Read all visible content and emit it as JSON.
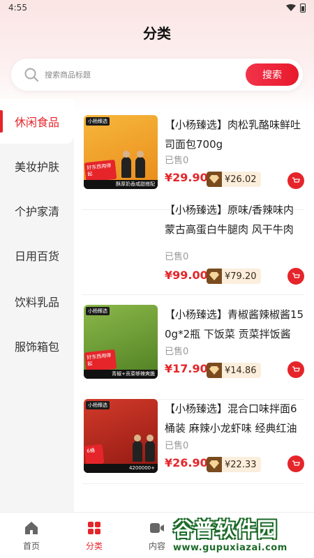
{
  "status_bar": {
    "time": "4:55"
  },
  "page_title": "分类",
  "search": {
    "placeholder": "搜索商品标题",
    "button_label": "搜索"
  },
  "sidebar": {
    "items": [
      {
        "label": "休闲食品",
        "active": true
      },
      {
        "label": "美妆护肤",
        "active": false
      },
      {
        "label": "个护家清",
        "active": false
      },
      {
        "label": "日用百货",
        "active": false
      },
      {
        "label": "饮料乳品",
        "active": false
      },
      {
        "label": "服饰箱包",
        "active": false
      }
    ]
  },
  "products": [
    {
      "title": "【小杨臻选】肉松乳酪味鲜吐司面包700g",
      "sold": "已售0",
      "price": "¥29.90",
      "vip_price": "¥26.02",
      "image": {
        "brand": "小杨臻选",
        "badge": "好东西用得起",
        "strip": "酥厚奶香咸甜搭配",
        "colors": [
          "#f6b73c",
          "#e98a1a"
        ]
      }
    },
    {
      "title": "【小杨臻选】原味/香辣味内蒙古高蛋白牛腿肉 风干牛肉",
      "sold": "已售0",
      "price": "¥99.00",
      "vip_price": "¥79.20",
      "image": null
    },
    {
      "title": "【小杨臻选】青椒酱辣椒酱150g*2瓶 下饭菜 贡菜拌饭酱",
      "sold": "已售0",
      "price": "¥17.90",
      "vip_price": "¥14.86",
      "image": {
        "brand": "小杨臻选",
        "badge": "好东西用得起",
        "strip": "青椒+贡菜够辣爽脆",
        "colors": [
          "#7fae3a",
          "#4f7f22"
        ]
      }
    },
    {
      "title": "【小杨臻选】混合口味拌面6桶装 麻辣小龙虾味 经典红油",
      "sold": "已售0",
      "price": "¥26.90",
      "vip_price": "¥22.33",
      "image": {
        "brand": "小杨臻选",
        "badge": "6桶",
        "strip": "4200000+",
        "colors": [
          "#c42a1e",
          "#8f1811"
        ]
      }
    }
  ],
  "tabbar": {
    "items": [
      {
        "label": "首页",
        "icon": "home-icon",
        "active": false
      },
      {
        "label": "分类",
        "icon": "category-icon",
        "active": true
      },
      {
        "label": "内容",
        "icon": "video-icon",
        "active": false
      }
    ]
  },
  "watermark": {
    "title": "谷普软件园",
    "url": "www.gupuxiazai.com"
  },
  "colors": {
    "accent": "#e5252a",
    "vip_bg": "#fbeedd",
    "vip_icon": "#7a4b1e"
  }
}
